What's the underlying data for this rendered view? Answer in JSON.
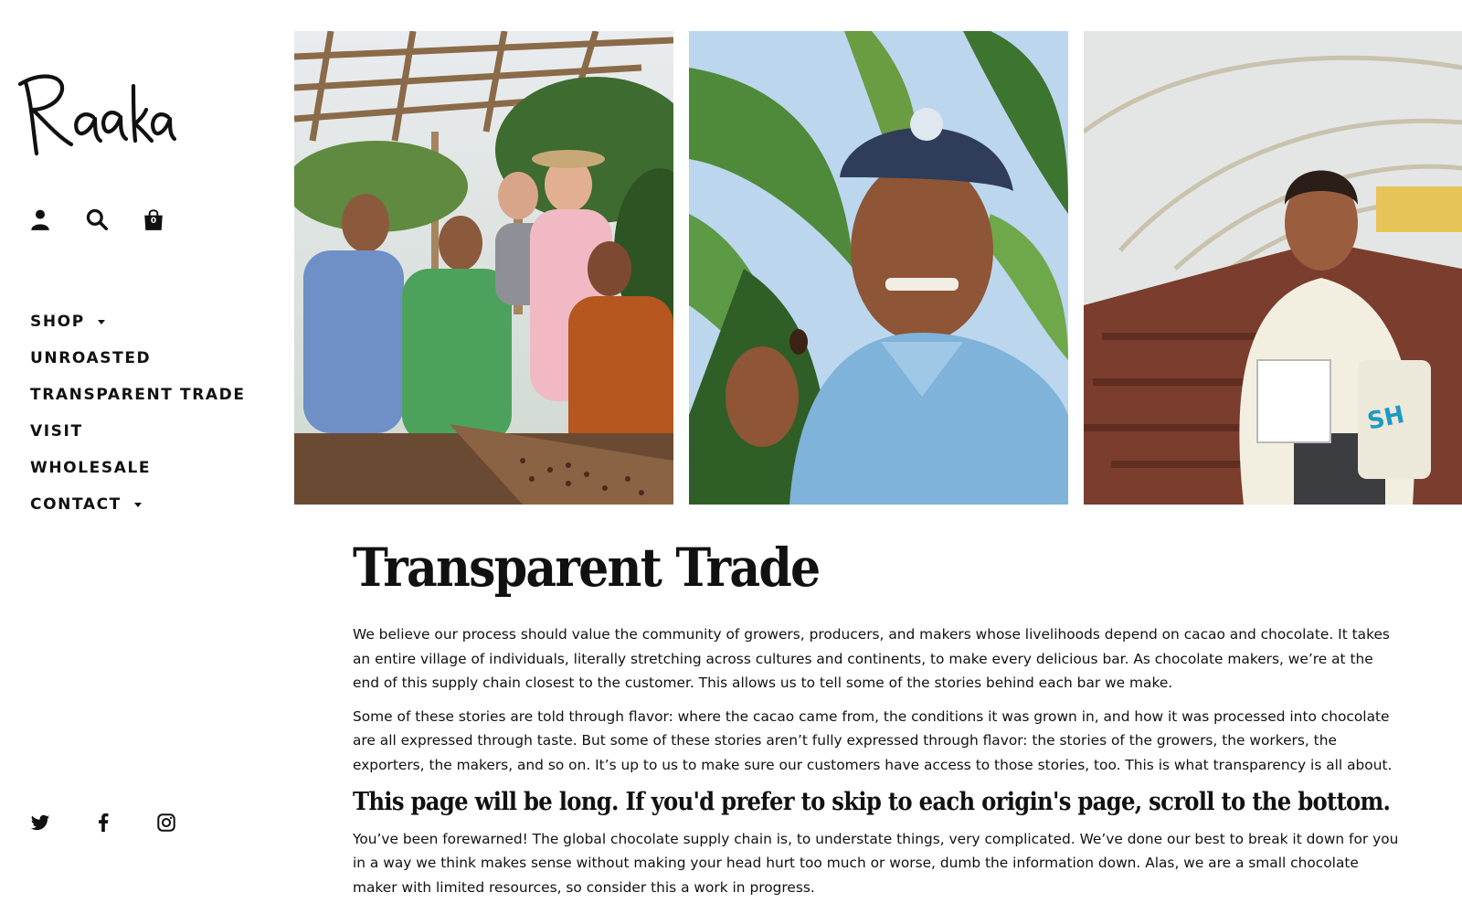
{
  "brand": {
    "logo_text": "Raaka"
  },
  "header_icons": {
    "account": "account-icon",
    "search": "search-icon",
    "cart": "shopping-bag-icon",
    "cart_count": "0"
  },
  "nav": {
    "items": [
      {
        "label": "SHOP",
        "has_dropdown": true
      },
      {
        "label": "UNROASTED",
        "has_dropdown": false
      },
      {
        "label": "TRANSPARENT TRADE",
        "has_dropdown": false
      },
      {
        "label": "VISIT",
        "has_dropdown": false
      },
      {
        "label": "WHOLESALE",
        "has_dropdown": false
      },
      {
        "label": "CONTACT",
        "has_dropdown": true
      }
    ]
  },
  "social": {
    "icons": [
      "twitter-icon",
      "facebook-icon",
      "instagram-icon"
    ]
  },
  "main": {
    "title": "Transparent Trade",
    "paragraphs": [
      "We believe our process should value the community of growers, producers, and makers whose livelihoods depend on cacao and chocolate. It takes an entire village of individuals, literally stretching across cultures and continents, to make every delicious bar. As chocolate makers, we’re at the end of this supply chain closest to the customer. This allows us to tell some of the stories behind each bar we make.",
      "Some of these stories are told through flavor: where the cacao came from, the conditions it was grown in, and how it was processed into chocolate are all expressed through taste. But some of these stories aren’t fully expressed through flavor: the stories of the growers, the workers, the exporters, the makers, and so on. It’s up to us to make sure our customers have access to those stories, too. This is what transparency is all about."
    ],
    "subheading": "This page will be long. If you'd prefer to skip to each origin's page, scroll to the bottom.",
    "paragraph_after": "You’ve been forewarned! The global chocolate supply chain is, to understate things, very complicated. We’ve done our best to break it down for you in a way we think makes sense without making your head hurt too much or worse, dumb the information down. Alas, we are a small chocolate maker with limited resources, so consider this a work in progress."
  },
  "colors": {
    "text": "#111111",
    "background": "#ffffff"
  }
}
